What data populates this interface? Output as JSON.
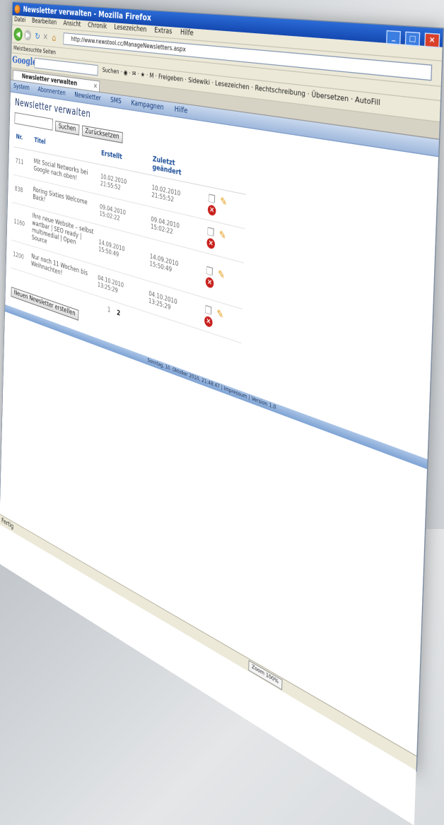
{
  "window": {
    "title": "Newsletter verwalten - Mozilla Firefox",
    "controls": [
      "_",
      "□",
      "×"
    ]
  },
  "menubar": [
    "Datei",
    "Bearbeiten",
    "Ansicht",
    "Chronik",
    "Lesezeichen",
    "Extras",
    "Hilfe"
  ],
  "navbar": {
    "url": "http://www.newstool.cc/ManageNewsletters.aspx"
  },
  "bookmarks": {
    "item": "Meistbesuchte Seiten"
  },
  "googlebar": {
    "logo": "Google",
    "tools": "Suchen · ◉ · ✉ · ★ · M · Freigeben · Sidewiki · Lesezeichen · Rechtschreibung · Übersetzen · AutoFill"
  },
  "tab": {
    "label": "Newsletter verwalten"
  },
  "appmenu": [
    "System",
    "Abonnenten",
    "Newsletter",
    "SMS",
    "Kampagnen",
    "Hilfe"
  ],
  "page": {
    "title": "Newsletter verwalten",
    "search_value": "",
    "search_button": "Suchen",
    "reset_button": "Zurücksetzen",
    "columns": [
      "Nr.",
      "Titel",
      "Erstellt",
      "Zuletzt geändert"
    ],
    "rows": [
      {
        "nr": "711",
        "title": "Mit Social Networks bei Google nach oben!",
        "created": "10.02.2010 21:55:52",
        "modified": "10.02.2010 21:55:52"
      },
      {
        "nr": "838",
        "title": "Roring Sixties Welcome Back!",
        "created": "09.04.2010 15:02:22",
        "modified": "09.04.2010 15:02:22"
      },
      {
        "nr": "1160",
        "title": "Ihre neue Website – selbst wartbar | SEO ready | multimedial | Open Source",
        "created": "14.09.2010 15:50:49",
        "modified": "14.09.2010 15:50:49"
      },
      {
        "nr": "1200",
        "title": "Nur noch 11 Wochen bis Weihnachten!",
        "created": "04.10.2010 13:25:29",
        "modified": "04.10.2010 13:25:29"
      }
    ],
    "pager": [
      "1",
      "2"
    ],
    "new_button": "Neuen Newsletter erstellen",
    "footer_text": "Sonntag, 10. Oktober 2010, 21:48:47 | Impressum | Version 1.0"
  },
  "statusbar": {
    "text": "Fertig",
    "zoom": "Zoom 100%"
  }
}
